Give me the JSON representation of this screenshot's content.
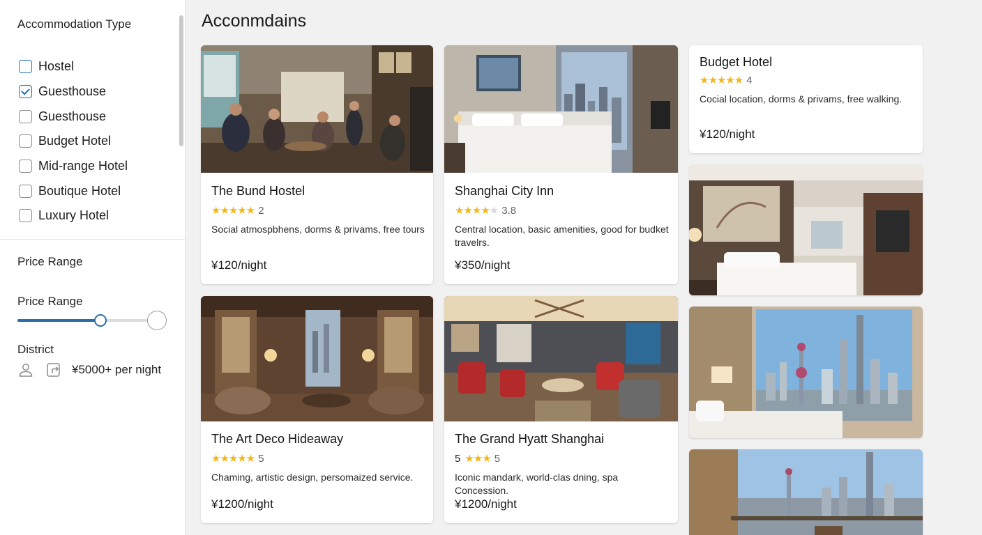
{
  "sidebar": {
    "type_title": "Accommodation Type",
    "types": [
      {
        "label": "Hostel",
        "checked": false
      },
      {
        "label": "Guesthouse",
        "checked": true
      },
      {
        "label": "Guesthouse",
        "checked": false
      },
      {
        "label": "Budget Hotel",
        "checked": false
      },
      {
        "label": "Mid-range Hotel",
        "checked": false
      },
      {
        "label": "Boutique Hotel",
        "checked": false
      },
      {
        "label": "Luxury Hotel",
        "checked": false
      }
    ],
    "price_section_title": "Price Range",
    "price_label": "Price Range",
    "district_label": "District",
    "district_value": "¥5000+ per night"
  },
  "main": {
    "title": "Acconmdains",
    "cards": [
      {
        "name": "The Bund Hostel",
        "stars": 5,
        "rating": "2",
        "desc": "Social atmospbhens, dorms & privams, free tours",
        "price": "¥120/night"
      },
      {
        "name": "Shanghai City Inn",
        "stars": 4,
        "rating": "3.8",
        "desc": "Central location, basic amenities, good for budket travelrs.",
        "price": "¥350/night"
      },
      {
        "name": "Budget Hotel",
        "stars": 5,
        "rating": "4",
        "desc": "Cocial location, dorms & privams, free walking.",
        "price": "¥120/night"
      },
      {
        "name": "The Art Deco Hideaway",
        "stars": 5,
        "rating": "5",
        "desc": "Chaming, artistic design, persomaized service.",
        "price": "¥1200/night"
      },
      {
        "name": "The Grand Hyatt Shanghai",
        "stars": 3,
        "rating_prefix": "5",
        "rating": "5",
        "desc": "Iconic mandark, world-clas dning, spa Concession.",
        "price": "¥1200/night"
      }
    ]
  },
  "colors": {
    "accent": "#2b6ea8",
    "star": "#f2b61c",
    "page_bg": "#f1f1f1"
  }
}
